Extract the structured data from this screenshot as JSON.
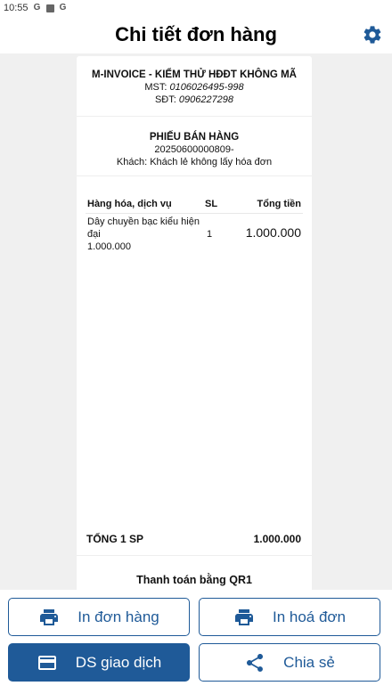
{
  "status_bar": {
    "time": "10:55"
  },
  "header": {
    "title": "Chi tiết đơn hàng",
    "settings_icon": "gear-icon"
  },
  "receipt": {
    "company": "M-INVOICE - KIỂM THỬ HĐĐT KHÔNG MÃ",
    "tax_label": "MST: ",
    "tax_value": "0106026495-998",
    "phone_label": "SĐT: ",
    "phone_value": "0906227298",
    "doc_title": "PHIẾU BÁN HÀNG",
    "doc_number": "20250600000809-",
    "customer": "Khách: Khách lẻ không lấy hóa đơn",
    "columns": {
      "item": "Hàng hóa, dịch vụ",
      "qty": "SL",
      "total": "Tổng tiền"
    },
    "items": [
      {
        "name_line1": "Dây chuyền bạc kiểu hiện",
        "name_line2": "đại",
        "unit_price": "1.000.000",
        "qty": "1",
        "total": "1.000.000"
      }
    ],
    "summary_label": "TỔNG 1 SP",
    "summary_value": "1.000.000",
    "payment": "Thanh toán bằng QR1"
  },
  "actions": {
    "print_order": "In đơn hàng",
    "print_invoice": "In hoá đơn",
    "transactions": "DS giao dịch",
    "share": "Chia sẻ"
  },
  "colors": {
    "primary": "#1f5a98"
  }
}
